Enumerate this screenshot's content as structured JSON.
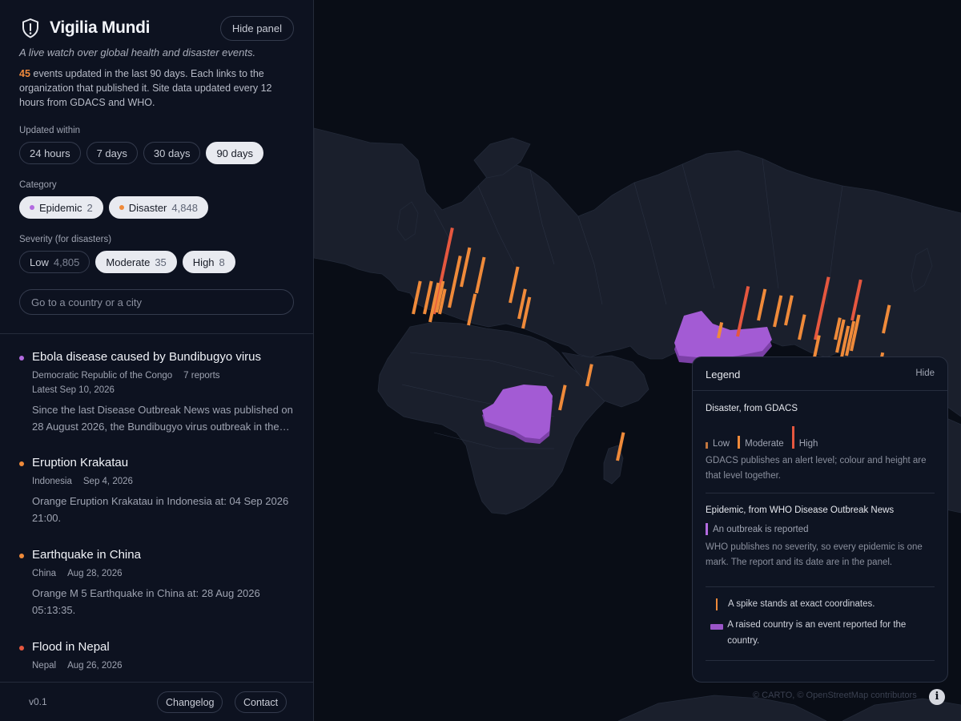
{
  "app": {
    "title": "Vigilia Mundi",
    "hide_panel_label": "Hide panel",
    "tagline": "A live watch over global health and disaster events.",
    "summary_count": "45",
    "summary_text": " events updated in the last 90 days. Each links to the organization that published it. Site data updated every 12 hours from GDACS and WHO."
  },
  "filters": {
    "updated_label": "Updated within",
    "updated_options": [
      {
        "label": "24 hours",
        "active": false
      },
      {
        "label": "7 days",
        "active": false
      },
      {
        "label": "30 days",
        "active": false
      },
      {
        "label": "90 days",
        "active": true
      }
    ],
    "category_label": "Category",
    "categories": [
      {
        "label": "Epidemic",
        "count": "2",
        "color": "#b36be0",
        "active": true
      },
      {
        "label": "Disaster",
        "count": "4,848",
        "color": "#ef8a3a",
        "active": true
      }
    ],
    "severity_label": "Severity (for disasters)",
    "severities": [
      {
        "label": "Low",
        "count": "4,805",
        "active": false
      },
      {
        "label": "Moderate",
        "count": "35",
        "active": true
      },
      {
        "label": "High",
        "count": "8",
        "active": true
      }
    ],
    "search_placeholder": "Go to a country or a city"
  },
  "events": [
    {
      "title": "Ebola disease caused by Bundibugyo virus",
      "meta": [
        "Democratic Republic of the Congo",
        "7 reports"
      ],
      "meta2": "Latest Sep 10, 2026",
      "desc": "Since the last Disease Outbreak News was published on 28 August 2026, the Bundibugyo virus outbreak in the Democratic Republic of the Congo has continued.",
      "color": "#b36be0"
    },
    {
      "title": "Eruption Krakatau",
      "meta": [
        "Indonesia",
        "Sep 4, 2026"
      ],
      "desc": "Orange Eruption Krakatau in Indonesia at: 04 Sep 2026 21:00.",
      "color": "#ef8a3a"
    },
    {
      "title": "Earthquake in China",
      "meta": [
        "China",
        "Aug 28, 2026"
      ],
      "desc": "Orange M 5 Earthquake in China at: 28 Aug 2026 05:13:35.",
      "color": "#ef8a3a"
    },
    {
      "title": "Flood in Nepal",
      "meta": [
        "Nepal",
        "Aug 26, 2026"
      ],
      "desc": "",
      "color": "#e5573f"
    }
  ],
  "footer": {
    "version": "v0.1",
    "changelog_label": "Changelog",
    "contact_label": "Contact"
  },
  "legend": {
    "title": "Legend",
    "hide_label": "Hide",
    "disaster_heading": "Disaster, from GDACS",
    "levels": [
      {
        "label": "Low",
        "color": "#c2763e"
      },
      {
        "label": "Moderate",
        "color": "#ef8a3a"
      },
      {
        "label": "High",
        "color": "#e5573f"
      }
    ],
    "disaster_note": "GDACS publishes an alert level; colour and height are that level together.",
    "epidemic_heading": "Epidemic, from WHO Disease Outbreak News",
    "epidemic_item": "An outbreak is reported",
    "epidemic_color": "#b36be0",
    "epidemic_note": "WHO publishes no severity, so every epidemic is one mark. The report and its date are in the panel.",
    "spike_note": "A spike stands at exact coordinates.",
    "country_note": "A raised country is an event reported for the country."
  },
  "map": {
    "attribution": "© CARTO, © OpenStreetMap contributors",
    "info_label": "i",
    "spike_color_moderate": "#ef8a3a",
    "spike_color_high": "#e5573f",
    "raised_country_color": "#9a55c8"
  }
}
